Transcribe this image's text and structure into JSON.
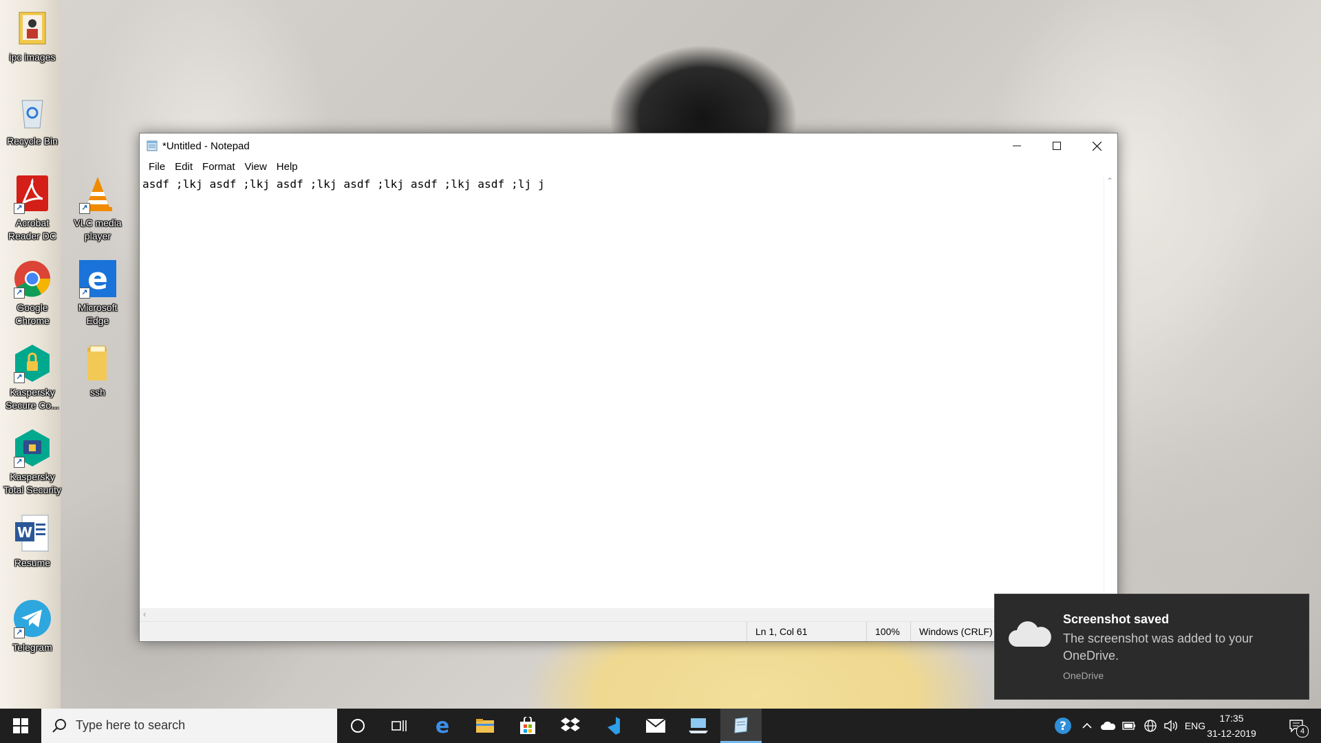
{
  "desktop": {
    "icons": [
      {
        "label": "ipc images",
        "icon": "photo-folder-icon"
      },
      {
        "label": "Recycle Bin",
        "icon": "recycle-bin-icon"
      },
      {
        "label": "Acrobat Reader DC",
        "icon": "acrobat-icon"
      },
      {
        "label": "VLC media player",
        "icon": "vlc-icon"
      },
      {
        "label": "Google Chrome",
        "icon": "chrome-icon"
      },
      {
        "label": "Microsoft Edge",
        "icon": "edge-icon"
      },
      {
        "label": "Kaspersky Secure Co...",
        "icon": "kaspersky-secure-icon"
      },
      {
        "label": "ssh",
        "icon": "folder-icon"
      },
      {
        "label": "Kaspersky Total Security",
        "icon": "kaspersky-total-icon"
      },
      {
        "label": "Resume",
        "icon": "word-doc-icon"
      },
      {
        "label": "Telegram",
        "icon": "telegram-icon"
      }
    ]
  },
  "notepad": {
    "title": "*Untitled - Notepad",
    "menu": [
      "File",
      "Edit",
      "Format",
      "View",
      "Help"
    ],
    "content": "asdf ;lkj asdf ;lkj asdf ;lkj asdf ;lkj asdf ;lkj asdf ;lj j",
    "status": {
      "position": "Ln 1, Col 61",
      "zoom": "100%",
      "line_ending": "Windows (CRLF)"
    }
  },
  "toast": {
    "title": "Screenshot saved",
    "body": "The screenshot was added to your OneDrive.",
    "source": "OneDrive",
    "icon": "onedrive-cloud-icon"
  },
  "taskbar": {
    "search_placeholder": "Type here to search",
    "pinned": [
      "cortana-icon",
      "task-view-icon",
      "edge-icon",
      "file-explorer-icon",
      "store-icon",
      "dropbox-icon",
      "visual-studio-icon",
      "mail-icon",
      "connect-icon",
      "notepad-icon"
    ],
    "tray": {
      "language": "ENG",
      "time": "17:35",
      "date": "31-12-2019",
      "notification_count": "4"
    }
  }
}
